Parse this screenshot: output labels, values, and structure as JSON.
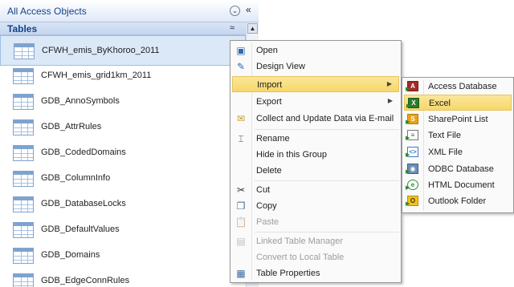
{
  "nav": {
    "title": "All Access Objects",
    "menu_glyph": "⌄",
    "shutter_glyph": "«",
    "group_title": "Tables",
    "group_collapse_glyph": "≈"
  },
  "tables": [
    {
      "label": "CFWH_emis_ByKhoroo_2011",
      "selected": true
    },
    {
      "label": "CFWH_emis_grid1km_2011"
    },
    {
      "label": "GDB_AnnoSymbols"
    },
    {
      "label": "GDB_AttrRules"
    },
    {
      "label": "GDB_CodedDomains"
    },
    {
      "label": "GDB_ColumnInfo"
    },
    {
      "label": "GDB_DatabaseLocks"
    },
    {
      "label": "GDB_DefaultValues"
    },
    {
      "label": "GDB_Domains"
    },
    {
      "label": "GDB_EdgeConnRules"
    }
  ],
  "context_menu": {
    "items": [
      {
        "label": "Open",
        "icon": "open-icon"
      },
      {
        "label": "Design View",
        "icon": "design-view-icon"
      },
      {
        "label": "Import",
        "submenu": true,
        "highlighted": true
      },
      {
        "label": "Export",
        "submenu": true
      },
      {
        "label": "Collect and Update Data via E-mail",
        "icon": "email-collect-icon"
      },
      {
        "label": "Rename",
        "icon": "rename-icon"
      },
      {
        "label": "Hide in this Group"
      },
      {
        "label": "Delete"
      },
      {
        "label": "Cut",
        "icon": "scissors-icon"
      },
      {
        "label": "Copy",
        "icon": "copy-icon"
      },
      {
        "label": "Paste",
        "icon": "paste-icon",
        "disabled": true
      },
      {
        "label": "Linked Table Manager",
        "icon": "linked-table-icon",
        "disabled": true
      },
      {
        "label": "Convert to Local Table",
        "disabled": true
      },
      {
        "label": "Table Properties",
        "icon": "properties-icon"
      }
    ]
  },
  "import_submenu": {
    "items": [
      {
        "label": "Access Database",
        "icon": "access-icon",
        "glyph": "A"
      },
      {
        "label": "Excel",
        "icon": "excel-icon",
        "glyph": "X",
        "highlighted": true
      },
      {
        "label": "SharePoint List",
        "icon": "sharepoint-icon",
        "glyph": "S"
      },
      {
        "label": "Text File",
        "icon": "text-file-icon",
        "glyph": "≡"
      },
      {
        "label": "XML File",
        "icon": "xml-file-icon",
        "glyph": "<>"
      },
      {
        "label": "ODBC Database",
        "icon": "odbc-icon",
        "glyph": "◉"
      },
      {
        "label": "HTML Document",
        "icon": "html-icon",
        "glyph": "e"
      },
      {
        "label": "Outlook Folder",
        "icon": "outlook-icon",
        "glyph": "O"
      }
    ]
  },
  "colors": {
    "accent": "#15428b",
    "highlight": "#f6d76a",
    "selection": "#dbe8f8"
  }
}
